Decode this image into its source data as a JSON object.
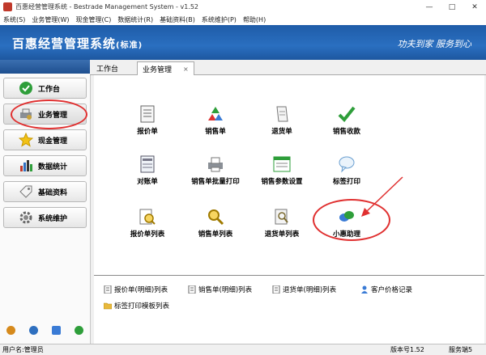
{
  "window": {
    "title": "百惠经营管理系统 - Bestrade Management System - v1.52",
    "controls": [
      "—",
      "□",
      "✕"
    ]
  },
  "menu": [
    "系统(S)",
    "业务管理(W)",
    "现金管理(C)",
    "数据统计(R)",
    "基础资料(B)",
    "系统维护(P)",
    "帮助(H)"
  ],
  "banner": {
    "system_name": "百惠经营管理系统",
    "edition": "(标准)",
    "slogan": "功夫到家  服务到心"
  },
  "sidebar": {
    "items": [
      {
        "label": "工作台",
        "icon": "check-icon"
      },
      {
        "label": "业务管理",
        "icon": "printer-gear-icon"
      },
      {
        "label": "现金管理",
        "icon": "star-icon"
      },
      {
        "label": "数据统计",
        "icon": "bar-chart-icon"
      },
      {
        "label": "基础资料",
        "icon": "tag-icon"
      },
      {
        "label": "系统维护",
        "icon": "gear-icon"
      }
    ],
    "active": "业务管理"
  },
  "tabs": [
    {
      "label": "工作台"
    },
    {
      "label": "业务管理",
      "close": "×"
    }
  ],
  "modules": [
    {
      "label": "报价单",
      "icon": "document-icon"
    },
    {
      "label": "销售单",
      "icon": "recycle-icon"
    },
    {
      "label": "退货单",
      "icon": "scroll-icon"
    },
    {
      "label": "销售收款",
      "icon": "check-icon"
    },
    {
      "label": "对账单",
      "icon": "ledger-icon"
    },
    {
      "label": "销售单批量打印",
      "icon": "printer-icon"
    },
    {
      "label": "销售参数设置",
      "icon": "settings-window-icon"
    },
    {
      "label": "标签打印",
      "icon": "speech-bubble-icon"
    },
    {
      "label": "报价单列表",
      "icon": "search-document-icon"
    },
    {
      "label": "销售单列表",
      "icon": "magnifier-icon"
    },
    {
      "label": "退货单列表",
      "icon": "search-list-icon"
    },
    {
      "label": "小惠助理",
      "icon": "chat-bubbles-icon"
    }
  ],
  "quick_links": [
    {
      "label": "报价单(明细)列表",
      "icon": "list-document-icon"
    },
    {
      "label": "销售单(明细)列表",
      "icon": "list-document-icon"
    },
    {
      "label": "退货单(明细)列表",
      "icon": "list-document-icon"
    },
    {
      "label": "客户价格记录",
      "icon": "person-icon"
    },
    {
      "label": "标签打印模板列表",
      "icon": "folder-icon"
    }
  ],
  "status": {
    "user": "用户名:管理员",
    "version": "版本号1.52",
    "server": "服务端5"
  },
  "colors": {
    "banner": "#1f5ca8",
    "annotation": "#e03030"
  }
}
